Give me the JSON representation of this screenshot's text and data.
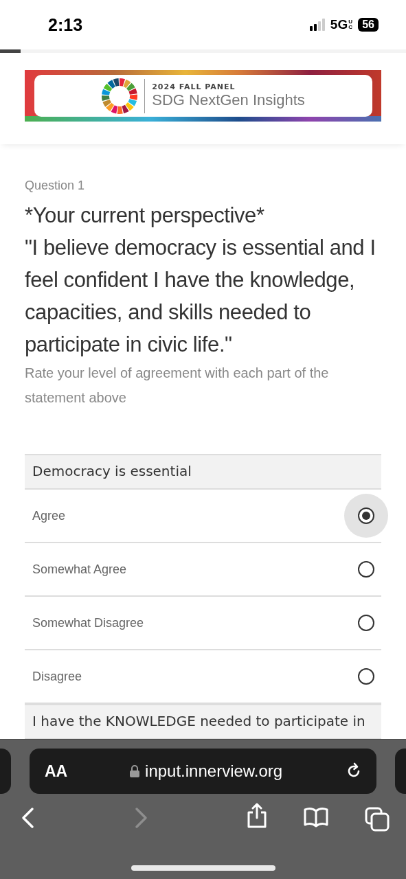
{
  "status_bar": {
    "time": "2:13",
    "network": "5G",
    "network_suffix": "UC",
    "battery": "56"
  },
  "progress": {
    "level": 0.05
  },
  "banner": {
    "eyebrow": "2024 FALL PANEL",
    "title": "SDG NextGen Insights"
  },
  "question": {
    "number": "Question 1",
    "heading": "*Your current perspective*",
    "statement": "\"I believe democracy is essential and I feel confident I have the knowledge, capacities, and skills needed to participate in civic life.\"",
    "instructions": "Rate your level of agreement with each part of the statement above"
  },
  "groups": [
    {
      "label": "Democracy is essential",
      "options": [
        {
          "label": "Agree",
          "selected": true
        },
        {
          "label": "Somewhat Agree",
          "selected": false
        },
        {
          "label": "Somewhat Disagree",
          "selected": false
        },
        {
          "label": "Disagree",
          "selected": false
        }
      ]
    },
    {
      "label": "I have the KNOWLEDGE needed to participate in"
    }
  ],
  "browser": {
    "text_size_label": "AA",
    "url": "input.innerview.org",
    "back_disabled": false,
    "forward_disabled": true
  }
}
